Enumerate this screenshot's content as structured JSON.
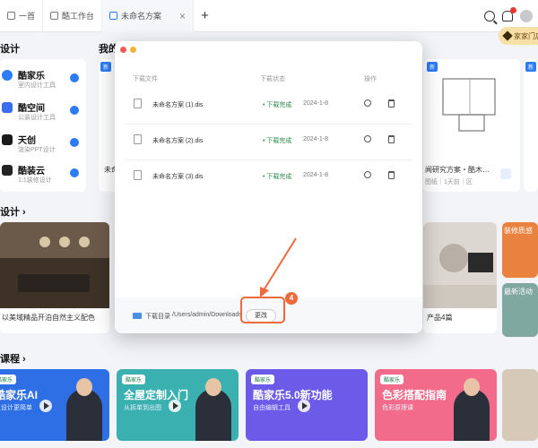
{
  "tabs": [
    {
      "label": "一首",
      "active": false
    },
    {
      "label": "酷工作台",
      "active": false
    },
    {
      "label": "未命名方案",
      "active": true
    }
  ],
  "tab_close_glyph": "×",
  "tab_add_glyph": "+",
  "topbar_icons": [
    "search-icon",
    "bell-icon",
    "avatar"
  ],
  "vip_label": "家家门店",
  "sections": {
    "design_tools": "设计",
    "my_designs": "我的",
    "recommend": "设计 ›",
    "courses": "课程 ›"
  },
  "tools": [
    {
      "name": "酷家乐",
      "sub": "室内设计工具",
      "color": "#2b7cf6"
    },
    {
      "name": "酷空间",
      "sub": "公装设计工具",
      "color": "#3a6ff2"
    },
    {
      "name": "天创",
      "sub": "渲染PPT设计",
      "color": "#1b1b1b"
    },
    {
      "name": "酷装云",
      "sub": "1:1装修设计",
      "color": "#222"
    }
  ],
  "cards_right": {
    "left_caption": "未命",
    "right_caption": "闻研究方案・酷木…",
    "right_sub": "图纸｜1天前｜区",
    "tag1": "新",
    "tag2": "新",
    "tag3": "新"
  },
  "banner_captions": {
    "left": "以美域精品开泊自然主义配色",
    "right": "产品4篇"
  },
  "right_promo": {
    "top": "装修质感",
    "mid": "最新活动"
  },
  "courses": [
    {
      "badge": "酷家乐",
      "title": "酷家乐AI",
      "sub": "让设计更简单",
      "bg": "#2f6fe6"
    },
    {
      "badge": "酷家乐",
      "title": "全屋定制入门",
      "sub": "从拆单到出图",
      "bg": "#3bb0b0"
    },
    {
      "badge": "酷家乐",
      "title": "酷家乐5.0新功能",
      "sub": "自由编辑工具",
      "bg": "#6b5be8"
    },
    {
      "badge": "酷家乐",
      "title": "色彩搭配指南",
      "sub": "色彩原理课",
      "bg": "#f36b8a"
    }
  ],
  "modal": {
    "columns": {
      "name": "下载文件",
      "status": "下载状态",
      "action": "操作"
    },
    "rows": [
      {
        "file": "未命名方案 (1).dis",
        "status": "• 下载完成",
        "time": "2024-1-8"
      },
      {
        "file": "未命名方案 (2).dis",
        "status": "• 下载完成",
        "time": "2024-1-8"
      },
      {
        "file": "未命名方案 (3).dis",
        "status": "• 下载完成",
        "time": "2024-1-8"
      }
    ],
    "footer_label": "下载目录",
    "footer_path": "/Users/admin/Downloads",
    "change_label": "更改"
  },
  "annotation": {
    "step": "4",
    "color": "#ef6a3a"
  }
}
